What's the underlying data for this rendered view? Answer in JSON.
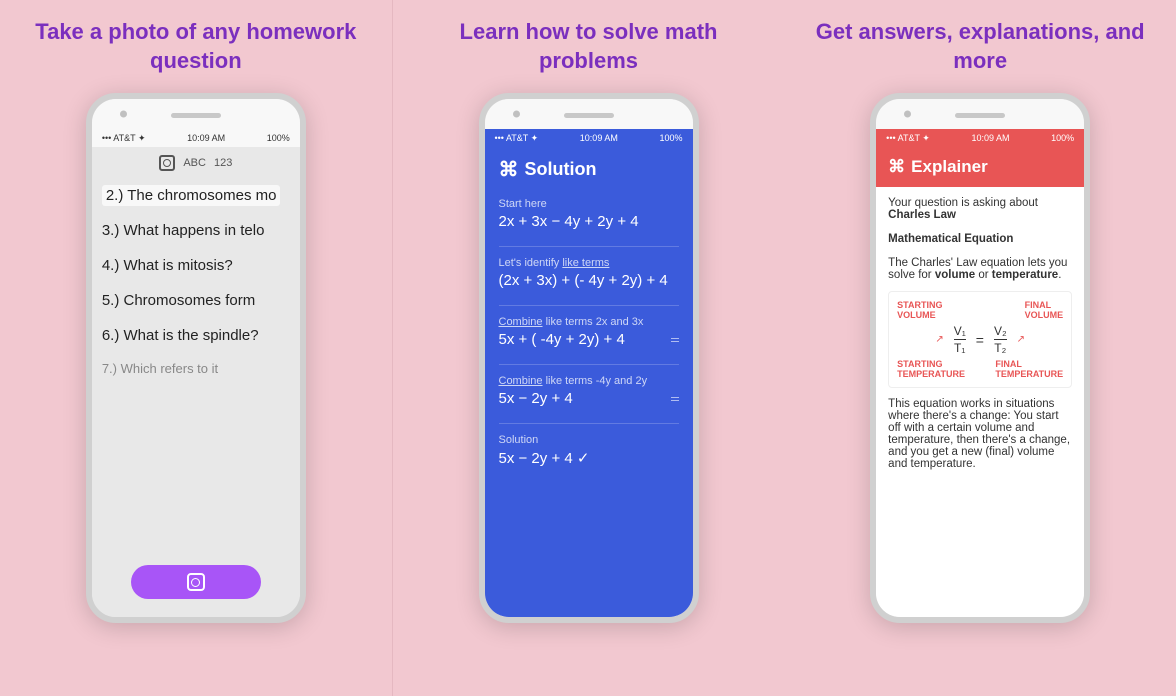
{
  "panels": [
    {
      "id": "panel1",
      "title": "Take a photo of any homework question",
      "phone": {
        "status": "AT&T ✦",
        "time": "10:09 AM",
        "battery": "100%",
        "top_icons": [
          "ABC",
          "123"
        ],
        "lines": [
          "2.) The chromosomes mo",
          "3.) What happens in telo",
          "4.) What is mitosis?",
          "5.) Chromosomes form",
          "6.) What is the spindle?",
          "7.) Which refers to it"
        ],
        "button_label": "camera"
      }
    },
    {
      "id": "panel2",
      "title": "Learn how to solve math problems",
      "phone": {
        "status": "AT&T ✦",
        "time": "10:09 AM",
        "battery": "100%",
        "header": "Solution",
        "steps": [
          {
            "label": "Start here",
            "expr": "2x + 3x − 4y + 2y + 4"
          },
          {
            "label": "Let's identify like terms",
            "expr": "(2x + 3x) + (- 4y + 2y) + 4"
          },
          {
            "label": "Combine like terms 2x and 3x",
            "expr": "5x + ( -4y + 2y) + 4",
            "has_arrow": true
          },
          {
            "label": "Combine like terms -4y and 2y",
            "expr": "5x − 2y + 4",
            "has_arrow": true
          },
          {
            "label": "Solution",
            "expr": "5x − 2y + 4  ✓"
          }
        ]
      }
    },
    {
      "id": "panel3",
      "title": "Get answers, explanations, and more",
      "phone": {
        "status": "AT&T ✦",
        "time": "10:09 AM",
        "battery": "100%",
        "header": "Explainer",
        "intro": "Your question is asking about",
        "topic": "Charles Law",
        "section_title": "Mathematical Equation",
        "description": "The Charles' Law equation lets you solve for",
        "highlight1": "volume",
        "connector": "or",
        "highlight2": "temperature",
        "diagram": {
          "top_left": "STARTING VOLUME",
          "top_right": "FINAL VOLUME",
          "v1": "V₁",
          "t1": "T₁",
          "v2": "V₂",
          "t2": "T₂",
          "bottom_left": "STARTING TEMPERATURE",
          "bottom_right": "FINAL TEMPERATURE"
        },
        "footnote": "This equation works in situations where there's a change: You start off with a certain volume and temperature, then there's a change, and you get a new (final) volume and temperature."
      }
    }
  ]
}
